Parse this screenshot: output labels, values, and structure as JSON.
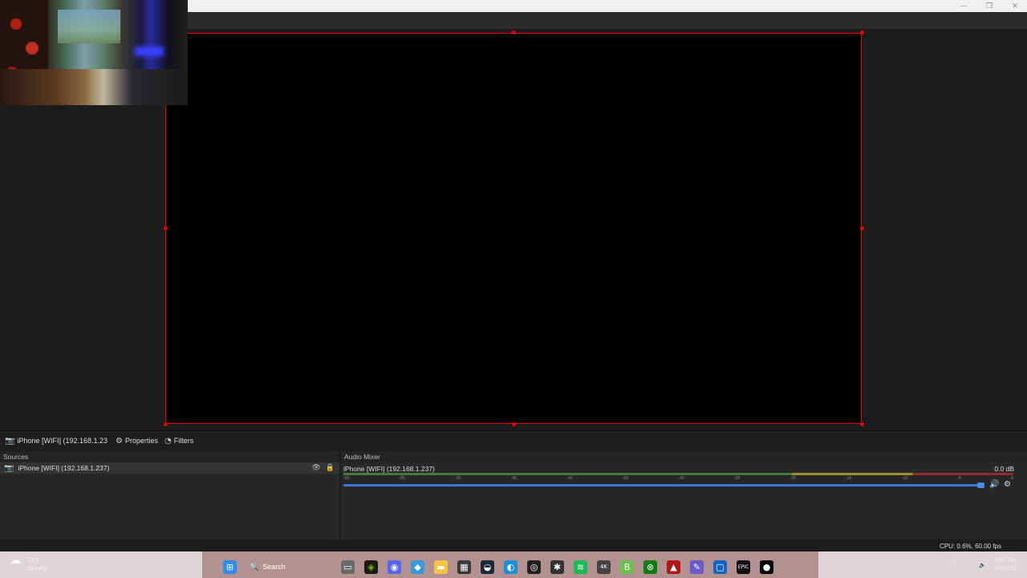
{
  "window": {
    "controls": {
      "minimize": "—",
      "restore": "❐",
      "close": "✕"
    }
  },
  "source_toolbar": {
    "current_source": "iPhone [WIFI] (192.168.1.23",
    "properties_label": "Properties",
    "filters_label": "Filters"
  },
  "sources": {
    "header": "Sources",
    "items": [
      {
        "name": "iPhone [WIFI] (192.168.1.237)"
      }
    ]
  },
  "audio_mixer": {
    "header": "Audio Mixer",
    "channels": [
      {
        "name": "iPhone [WIFI] (192.168.1.237)",
        "db": "0.0 dB",
        "volume": 1.0
      }
    ],
    "ticks": [
      "-60",
      "-55",
      "-50",
      "-45",
      "-40",
      "-35",
      "-30",
      "-25",
      "-20",
      "-15",
      "-10",
      "-5",
      "0"
    ]
  },
  "status": {
    "stats": "CPU: 0.6%, 60.00 fps"
  },
  "taskbar": {
    "weather": {
      "temp": "23°F",
      "condition": "Cloudy"
    },
    "search_label": "Search",
    "clock": {
      "time": "6:02 PM",
      "date": "2/4/2026"
    }
  },
  "colors": {
    "accent": "#e00000",
    "panel": "#272727",
    "slider": "#3e7ad0"
  }
}
